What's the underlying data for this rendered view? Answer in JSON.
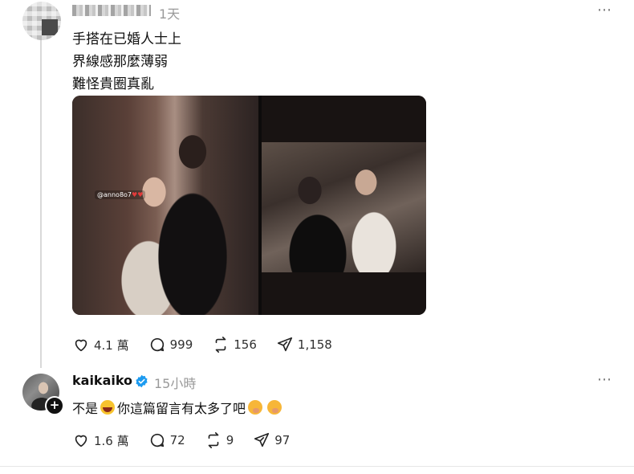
{
  "post1": {
    "time": "1天",
    "more_icon": "⋯",
    "lines": [
      "手搭在已婚人士上",
      "界線感那麼薄弱",
      "難怪貴圈真亂"
    ],
    "image": {
      "tag_text": "@anno8o7"
    },
    "stats": {
      "likes": "4.1 萬",
      "comments": "999",
      "reposts": "156",
      "shares": "1,158"
    }
  },
  "post2": {
    "username": "kaikaiko",
    "time": "15小時",
    "more_icon": "⋯",
    "avatar_badge": "+",
    "reply_parts": [
      "不是",
      "你這篇留言有太多了吧"
    ],
    "stats": {
      "likes": "1.6 萬",
      "comments": "72",
      "reposts": "9",
      "shares": "97"
    }
  },
  "colors": {
    "verified": "#1d9bf0",
    "text": "#101010",
    "muted": "#999999"
  }
}
